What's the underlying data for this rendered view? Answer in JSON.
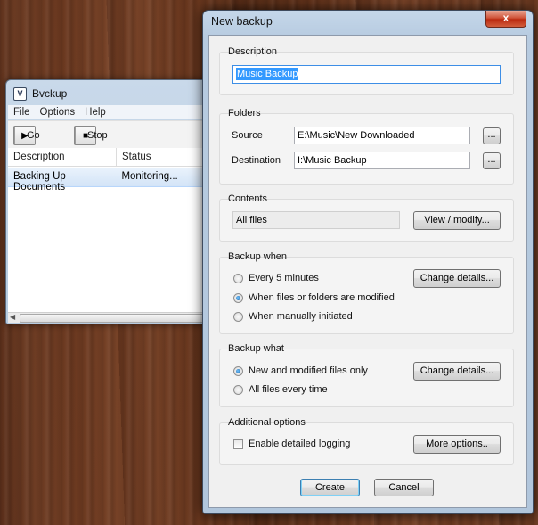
{
  "bvckup": {
    "title": "Bvckup",
    "logo_letter": "V",
    "menu": [
      "File",
      "Options",
      "Help"
    ],
    "toolbar": {
      "go_label": "Go",
      "go_icon": "play-icon",
      "go_glyph": "▶",
      "stop_label": "Stop",
      "stop_icon": "stop-icon",
      "stop_glyph": "■"
    },
    "columns": [
      "Description",
      "Status"
    ],
    "rows": [
      {
        "description": "Backing Up Documents",
        "status": "Monitoring..."
      }
    ]
  },
  "dialog": {
    "title": "New backup",
    "close_glyph": "x",
    "description": {
      "group": "Description",
      "value": "Music Backup"
    },
    "folders": {
      "group": "Folders",
      "source_label": "Source",
      "source_value": "E:\\Music\\New Downloaded",
      "destination_label": "Destination",
      "destination_value": "I:\\Music Backup",
      "browse_label": "..."
    },
    "contents": {
      "group": "Contents",
      "value": "All files",
      "button": "View / modify..."
    },
    "backup_when": {
      "group": "Backup when",
      "options": [
        "Every 5 minutes",
        "When files or folders are modified",
        "When manually initiated"
      ],
      "selected_index": 1,
      "button": "Change details..."
    },
    "backup_what": {
      "group": "Backup what",
      "options": [
        "New and modified files only",
        "All files every time"
      ],
      "selected_index": 0,
      "button": "Change details..."
    },
    "additional": {
      "group": "Additional options",
      "checkbox_label": "Enable detailed logging",
      "checked": false,
      "button": "More options.."
    },
    "create_label": "Create",
    "cancel_label": "Cancel"
  },
  "colors": {
    "selection": "#3399ff",
    "row_highlight": "#d3e4f7",
    "close_button": "#c9452a"
  }
}
